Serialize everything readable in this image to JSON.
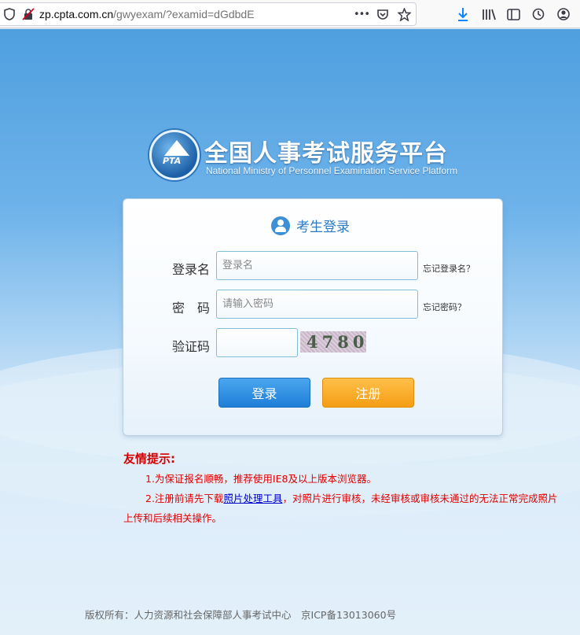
{
  "browser": {
    "url_domain": "zp.cpta.com.cn",
    "url_path": "/gwyexam/?examid=dGdbdE",
    "more_label": "•••"
  },
  "header": {
    "title_cn": "全国人事考试服务平台",
    "title_en": "National Ministry of Personnel Examination Service Platform",
    "logo_text": "PTA"
  },
  "login": {
    "title": "考生登录",
    "username_label": "登录名",
    "username_placeholder": "登录名",
    "forgot_username": "忘记登录名？",
    "password_label": "密　码",
    "password_placeholder": "请输入密码",
    "forgot_password": "忘记密码？",
    "captcha_label": "验证码",
    "captcha_value": "",
    "captcha_image_text": "4780",
    "login_button": "登录",
    "register_button": "注册"
  },
  "notice": {
    "title": "友情提示:",
    "item1": "1.为保证报名顺畅，推荐使用IE8及以上版本浏览器。",
    "item2_before": "2.注册前请先下载",
    "item2_link": "照片处理工具",
    "item2_after": "，对照片进行审核，未经审核或审核未通过的无法正常完成照片上传和后续相关操作。"
  },
  "footer": {
    "text": "版权所有：人力资源和社会保障部人事考试中心　京ICP备13013060号"
  }
}
